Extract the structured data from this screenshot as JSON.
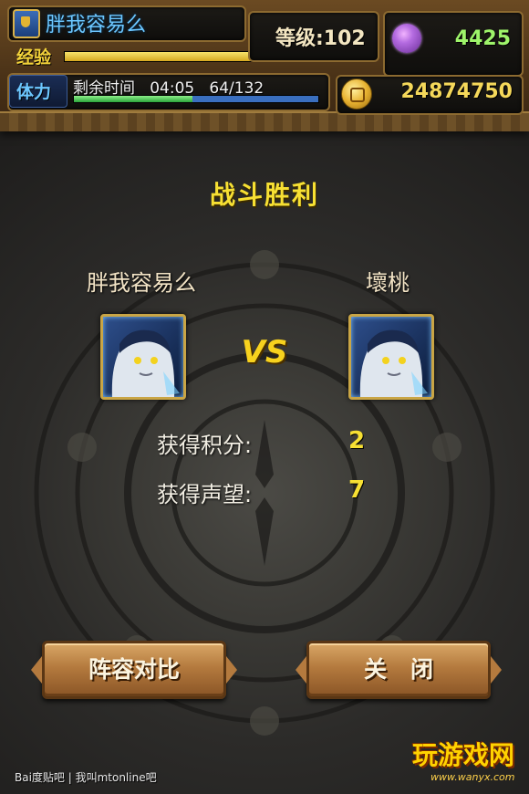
{
  "hud": {
    "player_name": "胖我容易么",
    "exp_label": "经验",
    "exp_progress": 0.78,
    "level_text": "等级:102",
    "gems": "4425",
    "energy_label": "体力",
    "energy_info": "剩余时间   04:05   64/132",
    "energy_progress": 0.485,
    "gold": "24874750",
    "colors": {
      "exp": "#f2d23a",
      "energy": "#6cc7ff",
      "gems": "#9ef46a",
      "gold": "#f5d85a"
    }
  },
  "battle": {
    "title": "战斗胜利",
    "player_left": "胖我容易么",
    "player_right": "壞桃",
    "vs": "VS",
    "stats": [
      {
        "label": "获得积分:",
        "value": "2"
      },
      {
        "label": "获得声望:",
        "value": "7"
      }
    ]
  },
  "buttons": {
    "compare": "阵容对比",
    "close": "关闭"
  },
  "watermark": {
    "baidu": "Bai度贴吧  |  我叫mtonline吧",
    "brand": "玩游戏网",
    "url": "www.wanyx.com"
  }
}
